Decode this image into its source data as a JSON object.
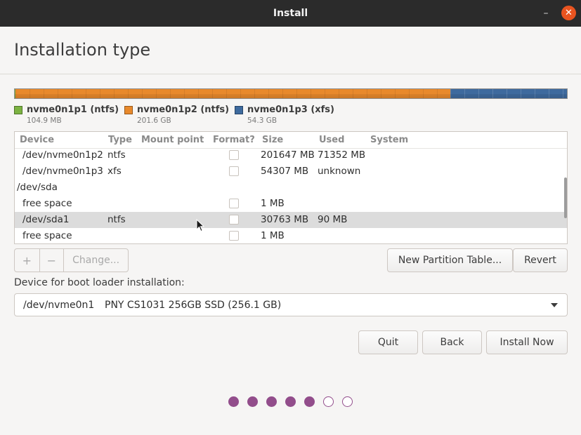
{
  "window": {
    "title": "Install",
    "minimize_glyph": "–",
    "close_glyph": "✕"
  },
  "page_title": "Installation type",
  "partition_bar": {
    "segments": [
      {
        "name": "nvme0n1p1 (ntfs)",
        "size": "104.9 MB",
        "color": "#7cb342",
        "fraction": 0.0004
      },
      {
        "name": "nvme0n1p2 (ntfs)",
        "size": "201.6 GB",
        "color": "#e8892c",
        "fraction": 0.7874
      },
      {
        "name": "nvme0n1p3 (xfs)",
        "size": "54.3 GB",
        "color": "#3e6a9e",
        "fraction": 0.2122
      }
    ]
  },
  "table": {
    "headers": {
      "device": "Device",
      "type": "Type",
      "mount": "Mount point",
      "format": "Format?",
      "size": "Size",
      "used": "Used",
      "system": "System"
    },
    "rows": [
      {
        "device": "/dev/nvme0n1p2",
        "type": "ntfs",
        "mount": "",
        "format": false,
        "size": "201647 MB",
        "used": "71352 MB",
        "system": ""
      },
      {
        "device": "/dev/nvme0n1p3",
        "type": "xfs",
        "mount": "",
        "format": false,
        "size": "54307 MB",
        "used": "unknown",
        "system": ""
      },
      {
        "device": "/dev/sda",
        "type": "",
        "mount": "",
        "size": "",
        "used": "",
        "system": ""
      },
      {
        "device": "free space",
        "type": "",
        "mount": "",
        "format": false,
        "size": "1 MB",
        "used": "",
        "system": ""
      },
      {
        "device": "/dev/sda1",
        "type": "ntfs",
        "mount": "",
        "format": false,
        "size": "30763 MB",
        "used": "90 MB",
        "system": "",
        "selected": true
      },
      {
        "device": "free space",
        "type": "",
        "mount": "",
        "format": false,
        "size": "1 MB",
        "used": "",
        "system": ""
      }
    ]
  },
  "buttons": {
    "add": "+",
    "remove": "−",
    "change": "Change...",
    "new_partition_table": "New Partition Table...",
    "revert": "Revert",
    "quit": "Quit",
    "back": "Back",
    "install_now": "Install Now"
  },
  "bootloader": {
    "label": "Device for boot loader installation:",
    "device": "/dev/nvme0n1",
    "description": "PNY CS1031 256GB SSD (256.1 GB)"
  },
  "progress": {
    "total_steps": 7,
    "completed_steps": 5,
    "accent_color": "#924d8b"
  }
}
